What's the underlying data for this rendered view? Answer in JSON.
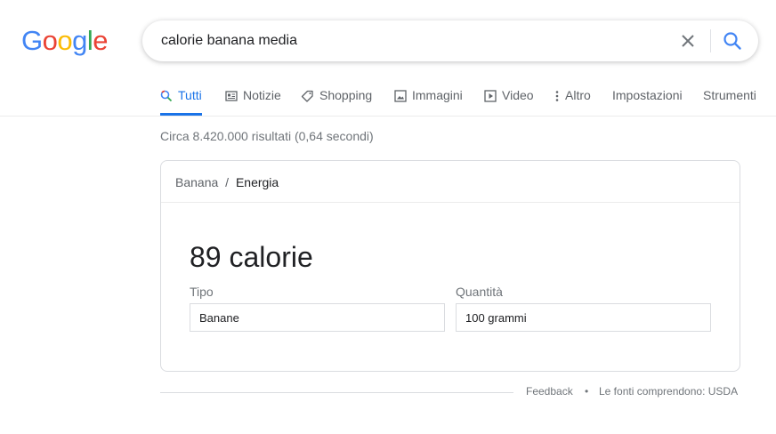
{
  "logo": {
    "letters": [
      "G",
      "o",
      "o",
      "g",
      "l",
      "e"
    ],
    "colors": [
      "#4285f4",
      "#ea4335",
      "#fbbc05",
      "#4285f4",
      "#34a853",
      "#ea4335"
    ]
  },
  "search": {
    "query": "calorie banana media",
    "clear_icon": "close-icon",
    "submit_icon": "search-icon"
  },
  "tabs": [
    {
      "label": "Tutti",
      "icon": "search-icon",
      "active": true
    },
    {
      "label": "Notizie",
      "icon": "news-icon"
    },
    {
      "label": "Shopping",
      "icon": "tag-icon"
    },
    {
      "label": "Immagini",
      "icon": "image-icon"
    },
    {
      "label": "Video",
      "icon": "video-icon"
    },
    {
      "label": "Altro",
      "icon": "more-vert-icon"
    },
    {
      "label": "Impostazioni"
    },
    {
      "label": "Strumenti"
    }
  ],
  "stats": "Circa 8.420.000 risultati (0,64 secondi)",
  "card": {
    "breadcrumb": {
      "root": "Banana",
      "sep": "/",
      "current": "Energia"
    },
    "value": "89 calorie",
    "type_label": "Tipo",
    "type_value": "Banane",
    "qty_label": "Quantità",
    "qty_value": "100 grammi"
  },
  "footer": {
    "feedback": "Feedback",
    "dot": "•",
    "sources": "Le fonti comprendono: USDA"
  },
  "colors": {
    "accent": "#1a73e8",
    "text_secondary": "#5f6368",
    "text_muted": "#70757a"
  }
}
